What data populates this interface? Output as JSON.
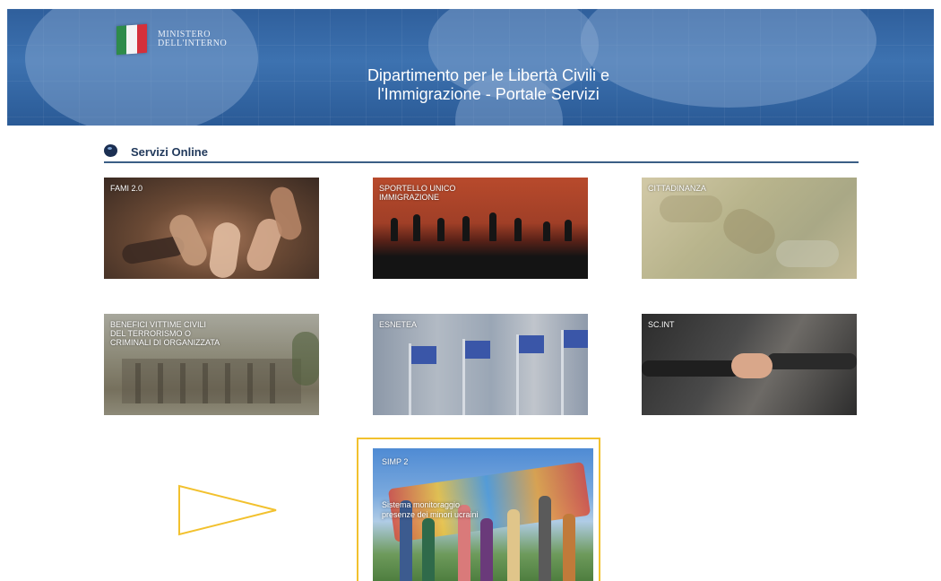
{
  "header": {
    "ministry_line1": "MINISTERO",
    "ministry_line2": "DELL'INTERNO",
    "title_line1": "Dipartimento per le Libertà Civili e",
    "title_line2": "l'Immigrazione - Portale Servizi"
  },
  "section": {
    "title": "Servizi Online"
  },
  "tiles": {
    "fami": {
      "label": "FAMI 2.0"
    },
    "sportello": {
      "line1": "SPORTELLO UNICO",
      "line2": "IMMIGRAZIONE"
    },
    "cittadinanza": {
      "label": "CITTADINANZA"
    },
    "benefici": {
      "line1": "BENEFICI VITTIME CIVILI",
      "line2": "DEL TERRORISMO O",
      "line3": "CRIMINALI DI ORGANIZZATA"
    },
    "esnetea": {
      "label": "ESNETEA"
    },
    "scint": {
      "label": "SC.INT"
    },
    "simp": {
      "label": "SIMP 2",
      "desc_line1": "Sistema monitoraggio",
      "desc_line2": "presenze dei minori ucraini"
    }
  },
  "colors": {
    "banner": "#2f5f9c",
    "section_rule": "#3a5e85",
    "highlight": "#f2c12e"
  }
}
